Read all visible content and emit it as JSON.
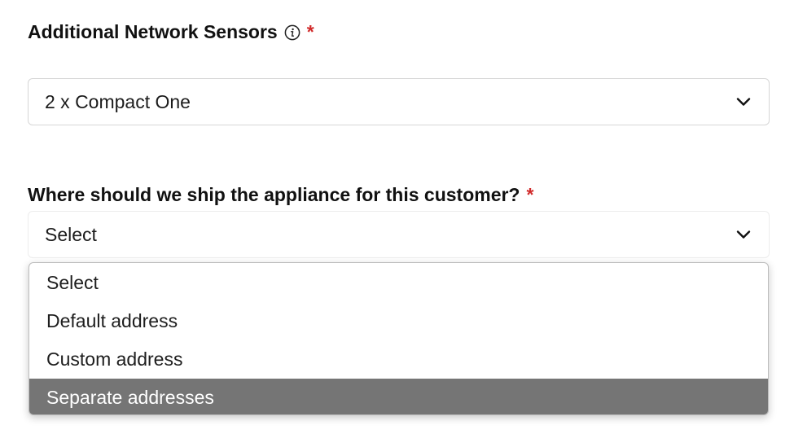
{
  "network_sensors": {
    "label": "Additional Network Sensors",
    "required_marker": "*",
    "info_icon": "info-icon",
    "selected_value": "2 x Compact One",
    "chevron_icon": "chevron-down-icon"
  },
  "shipping": {
    "label": "Where should we ship the appliance for this customer?",
    "required_marker": "*",
    "selected_value": "Select",
    "chevron_icon": "chevron-down-icon",
    "options": [
      {
        "label": "Select"
      },
      {
        "label": "Default address"
      },
      {
        "label": "Custom address"
      },
      {
        "label": "Separate addresses",
        "highlighted": true
      }
    ]
  },
  "colors": {
    "required": "#d12b2b",
    "highlight_bg": "#757575",
    "highlight_text": "#ffffff"
  }
}
